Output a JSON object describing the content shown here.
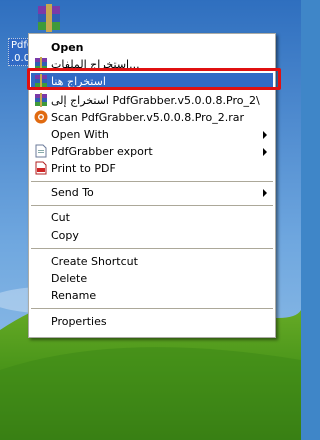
{
  "desktop": {
    "file_label_line1": "PdfG",
    "file_label_line2": ".0.0."
  },
  "context_menu": {
    "items": {
      "open": "Open",
      "extract_files": "استخراج الملفات...",
      "extract_here": "استخراج هنا",
      "extract_to": "استخراج إلى PdfGrabber.v5.0.0.8.Pro_2\\",
      "scan": "Scan PdfGrabber.v5.0.0.8.Pro_2.rar",
      "open_with": "Open With",
      "pdfgrabber_export": "PdfGrabber export",
      "print_to_pdf": "Print to PDF",
      "send_to": "Send To",
      "cut": "Cut",
      "copy": "Copy",
      "create_shortcut": "Create Shortcut",
      "delete": "Delete",
      "rename": "Rename",
      "properties": "Properties"
    },
    "highlighted_item": "extract_here",
    "highlight_color": "#316ac5",
    "annotation_box_color": "#e01010"
  }
}
